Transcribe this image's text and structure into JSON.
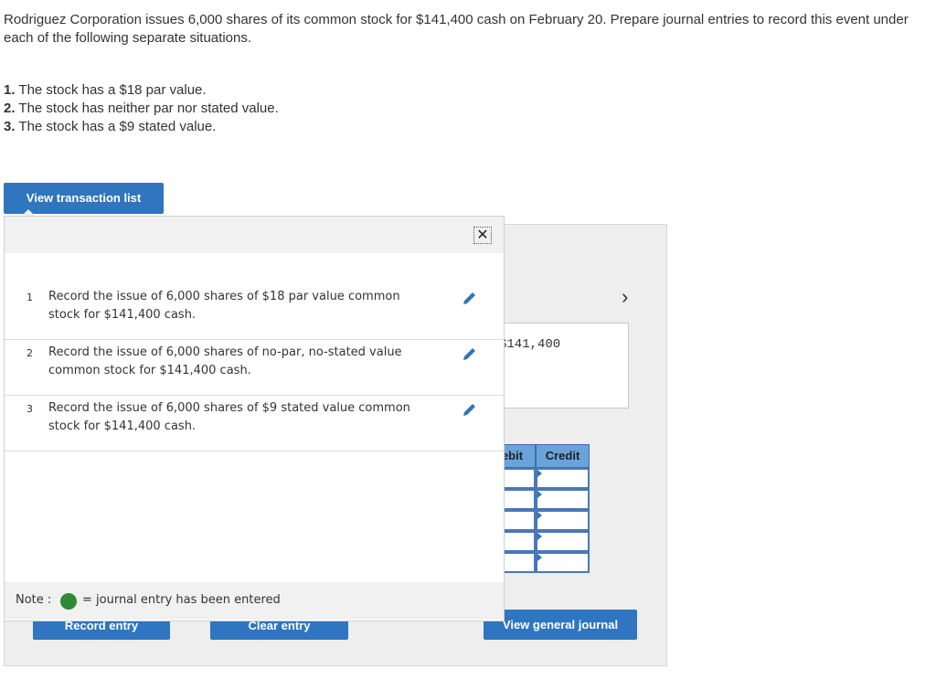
{
  "question": "Rodriguez Corporation issues 6,000 shares of its common stock for $141,400 cash on February 20. Prepare journal entries to record this event under each of the following separate situations.",
  "requirements": [
    {
      "num": "1.",
      "text": "The stock has a $18 par value."
    },
    {
      "num": "2.",
      "text": "The stock has neither par nor stated value."
    },
    {
      "num": "3.",
      "text": "The stock has a $9 stated value."
    }
  ],
  "view_transaction_list_label": "View transaction list",
  "popup": {
    "close_glyph": "✕",
    "transactions": [
      {
        "num": "1",
        "text": "Record the issue of 6,000 shares of $18 par value common stock for $141,400 cash."
      },
      {
        "num": "2",
        "text": "Record the issue of 6,000 shares of no-par, no-stated value common stock for $141,400 cash."
      },
      {
        "num": "3",
        "text": "Record the issue of 6,000 shares of $9 stated value common stock for $141,400 cash."
      }
    ],
    "note_label": "Note :",
    "note_text": "= journal entry has been entered"
  },
  "journal": {
    "next_glyph": "›",
    "amount_text": "$141,400",
    "col_debit": "ebit",
    "col_credit": "Credit"
  },
  "buttons": {
    "record": "Record entry",
    "clear": "Clear entry",
    "view_general_journal": "View general journal"
  },
  "colors": {
    "accent": "#2f75c0",
    "entered_dot": "#2e8b34",
    "grid_header": "#6aa3d9"
  }
}
